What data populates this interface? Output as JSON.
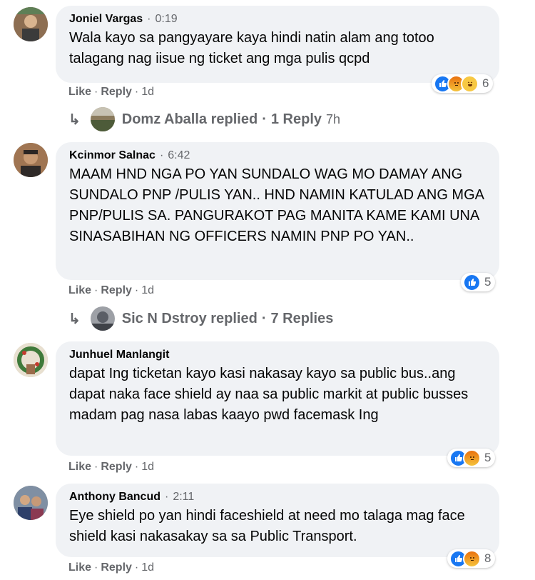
{
  "comments": [
    {
      "author": "Joniel Vargas",
      "time": "0:19",
      "text": "Wala kayo sa pangyayare kaya hindi natin alam ang totoo talagang nag iisue ng ticket ang mga pulis qcpd",
      "reactions": {
        "icons": [
          "like-icon",
          "angry-icon",
          "haha-icon"
        ],
        "count": "6"
      },
      "actions": {
        "like": "Like",
        "reply": "Reply",
        "age": "1d"
      },
      "replies": {
        "name": "Domz Aballa replied",
        "count": "1 Reply",
        "age": "7h"
      }
    },
    {
      "author": "Kcinmor Salnac",
      "time": "6:42",
      "text": "MAAM HND NGA PO YAN SUNDALO WAG MO DAMAY ANG SUNDALO PNP /PULIS YAN.. HND NAMIN KATULAD ANG MGA PNP/PULIS SA. PANGURAKOT PAG MANITA KAME KAMI UNA SINASABIHAN NG OFFICERS NAMIN PNP PO YAN..",
      "reactions": {
        "icons": [
          "like-icon"
        ],
        "count": "5"
      },
      "actions": {
        "like": "Like",
        "reply": "Reply",
        "age": "1d"
      },
      "replies": {
        "name": "Sic N Dstroy replied",
        "count": "7 Replies",
        "age": ""
      }
    },
    {
      "author": "Junhuel Manlangit",
      "time": "",
      "text": "dapat Ing ticketan kayo kasi nakasay kayo sa public bus..ang dapat naka face shield ay naa sa public markit at public busses madam pag nasa labas kaayo pwd facemask Ing",
      "reactions": {
        "icons": [
          "like-icon",
          "angry-icon"
        ],
        "count": "5"
      },
      "actions": {
        "like": "Like",
        "reply": "Reply",
        "age": "1d"
      }
    },
    {
      "author": "Anthony Bancud",
      "time": "2:11",
      "text": "Eye shield po yan hindi faceshield at need mo talaga mag face shield kasi nakasakay sa sa Public Transport.",
      "reactions": {
        "icons": [
          "like-icon",
          "angry-icon"
        ],
        "count": "8"
      },
      "actions": {
        "like": "Like",
        "reply": "Reply",
        "age": "1d"
      }
    }
  ],
  "ui": {
    "separator": "·",
    "reply_arrow": "↳"
  }
}
